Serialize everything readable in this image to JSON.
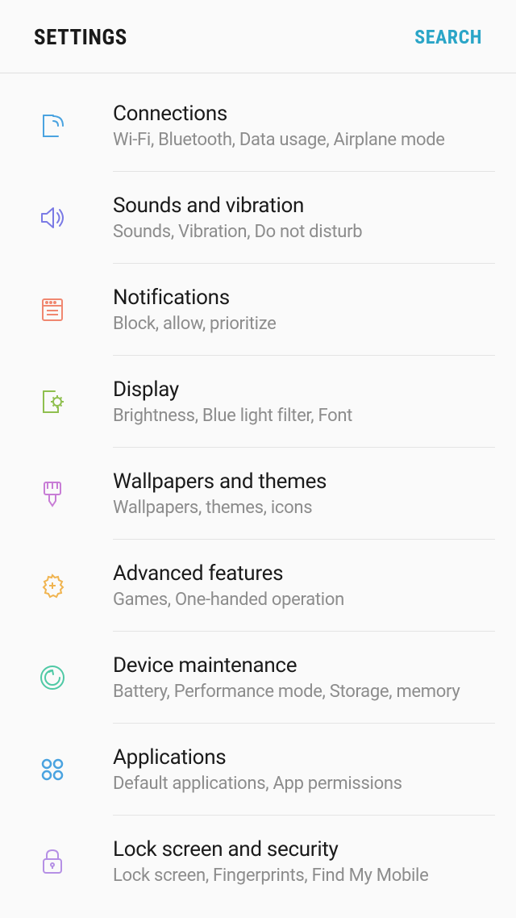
{
  "header": {
    "title": "SETTINGS",
    "search": "SEARCH"
  },
  "items": [
    {
      "title": "Connections",
      "subtitle": "Wi-Fi, Bluetooth, Data usage, Airplane mode",
      "icon": "connections",
      "color": "#4aa3e0"
    },
    {
      "title": "Sounds and vibration",
      "subtitle": "Sounds, Vibration, Do not disturb",
      "icon": "sound",
      "color": "#7a7ae5"
    },
    {
      "title": "Notifications",
      "subtitle": "Block, allow, prioritize",
      "icon": "notifications",
      "color": "#f08770"
    },
    {
      "title": "Display",
      "subtitle": "Brightness, Blue light filter, Font",
      "icon": "display",
      "color": "#8fbf4f"
    },
    {
      "title": "Wallpapers and themes",
      "subtitle": "Wallpapers, themes, icons",
      "icon": "wallpaper",
      "color": "#c87dd6"
    },
    {
      "title": "Advanced features",
      "subtitle": "Games, One-handed operation",
      "icon": "advanced",
      "color": "#f0b450"
    },
    {
      "title": "Device maintenance",
      "subtitle": "Battery, Performance mode, Storage, memory",
      "icon": "maintenance",
      "color": "#4fc9a5"
    },
    {
      "title": "Applications",
      "subtitle": "Default applications, App permissions",
      "icon": "apps",
      "color": "#4aa3e0"
    },
    {
      "title": "Lock screen and security",
      "subtitle": "Lock screen, Fingerprints, Find My Mobile",
      "icon": "lock",
      "color": "#b590e5"
    }
  ]
}
